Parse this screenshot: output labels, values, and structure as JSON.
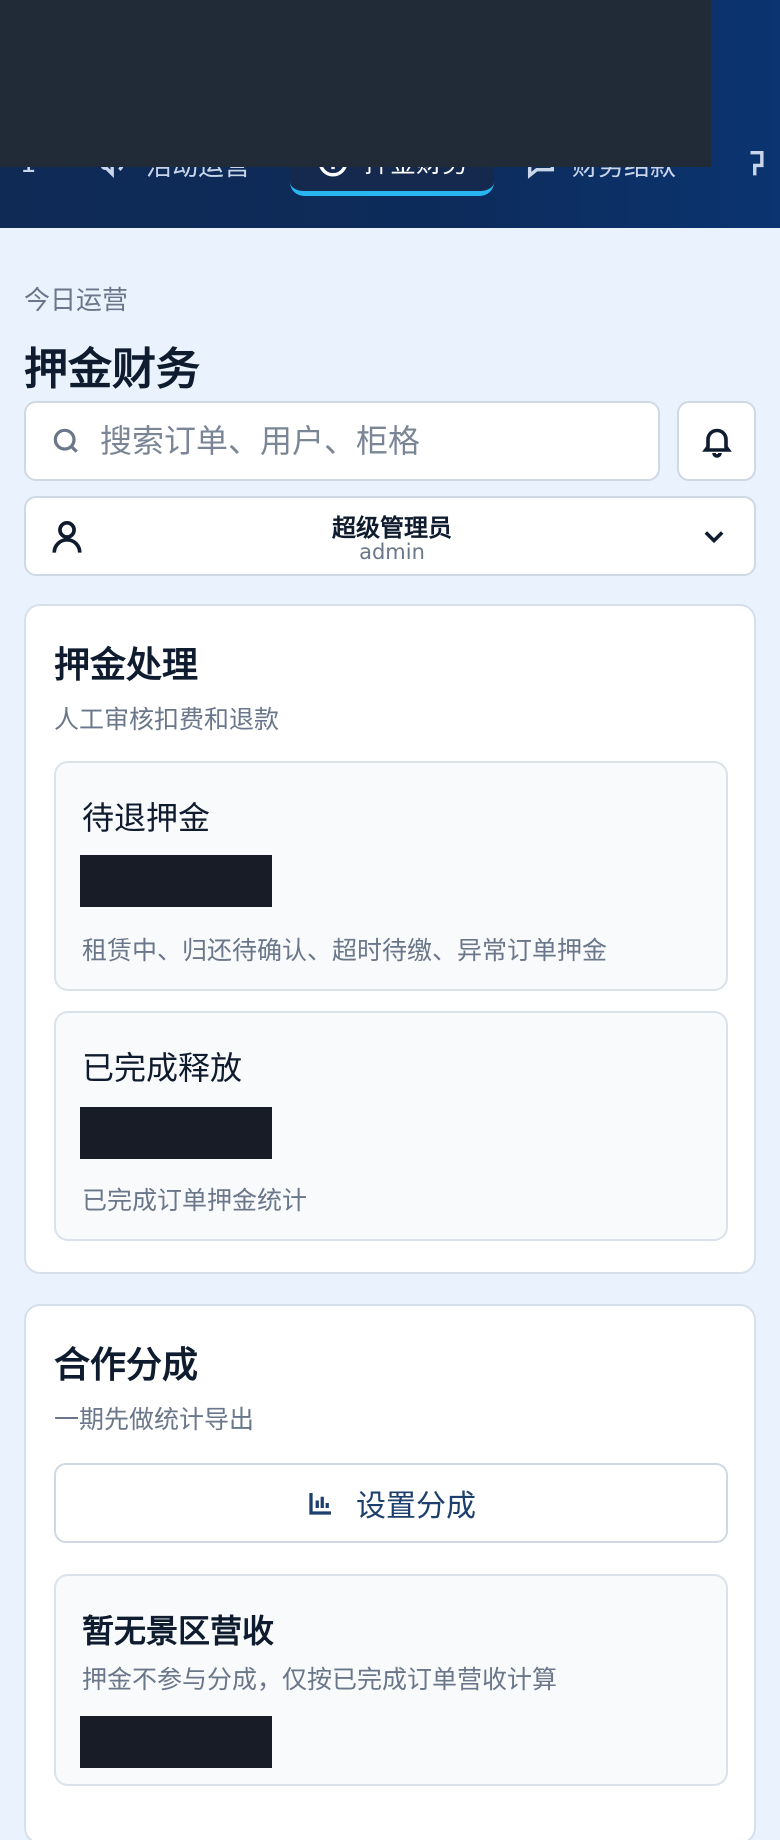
{
  "nav": {
    "items": [
      {
        "label": "活动运营",
        "icon": "megaphone-icon"
      },
      {
        "label": "押金财务",
        "icon": "coin-icon",
        "active": true
      },
      {
        "label": "财务结款",
        "icon": "message-icon"
      }
    ]
  },
  "header": {
    "eyebrow": "今日运营",
    "title": "押金财务"
  },
  "search": {
    "placeholder": "搜索订单、用户、柜格"
  },
  "user": {
    "name": "超级管理员",
    "id": "admin"
  },
  "deposit_section": {
    "title": "押金处理",
    "subtitle": "人工审核扣费和退款",
    "cards": [
      {
        "title": "待退押金",
        "desc": "租赁中、归还待确认、超时待缴、异常订单押金"
      },
      {
        "title": "已完成释放",
        "desc": "已完成订单押金统计"
      }
    ]
  },
  "share_section": {
    "title": "合作分成",
    "subtitle": "一期先做统计导出",
    "button_label": "设置分成",
    "empty_card": {
      "title": "暂无景区营收",
      "desc": "押金不参与分成，仅按已完成订单营收计算"
    }
  }
}
